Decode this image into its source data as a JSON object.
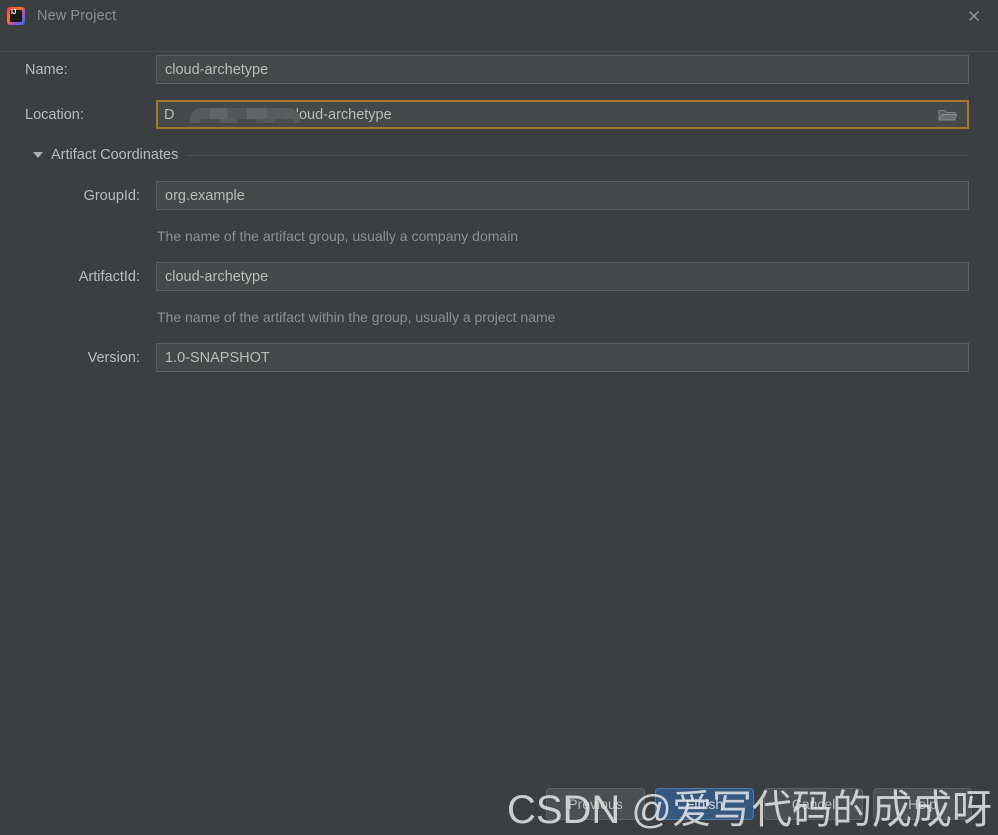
{
  "window": {
    "title": "New Project",
    "logo_icon": "intellij-idea-logo",
    "close_icon": "close-icon"
  },
  "colors": {
    "background": "#3c3f41",
    "field_background": "#45494a",
    "field_border": "#5e6060",
    "focus_border": "#a5792b",
    "label_text": "#bbbbbb",
    "hint_text": "#8d9091",
    "default_button": "#365880"
  },
  "form": {
    "name": {
      "label": "Name:",
      "value": "cloud-archetype"
    },
    "location": {
      "label": "Location:",
      "value_prefix": "D",
      "value_suffix": "\\cloud-archetype",
      "redacted": true,
      "browse_icon": "folder-icon"
    },
    "artifact_section": {
      "label": "Artifact Coordinates",
      "expanded": true,
      "collapse_icon": "chevron-down-icon"
    },
    "group_id": {
      "label": "GroupId:",
      "value": "org.example",
      "hint": "The name of the artifact group, usually a company domain"
    },
    "artifact_id": {
      "label": "ArtifactId:",
      "value": "cloud-archetype",
      "hint": "The name of the artifact within the group, usually a project name"
    },
    "version": {
      "label": "Version:",
      "value": "1.0-SNAPSHOT"
    }
  },
  "buttons": {
    "previous": "Previous",
    "finish": "Finish",
    "cancel": "Cancel",
    "help": "Help"
  },
  "watermark": {
    "text": "CSDN @爱写代码的成成呀"
  }
}
